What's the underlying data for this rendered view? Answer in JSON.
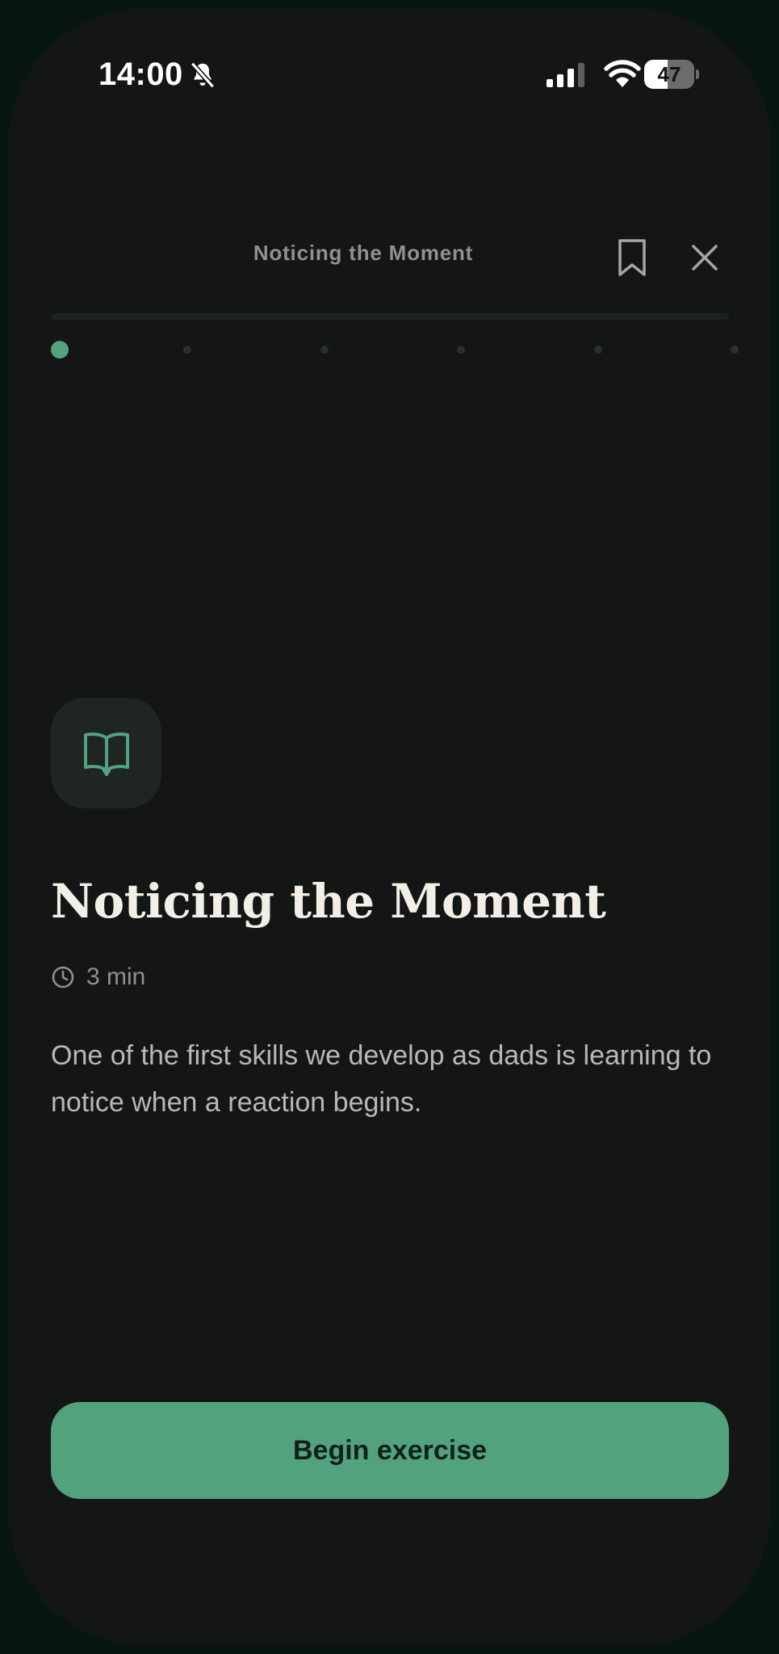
{
  "status_bar": {
    "time": "14:00",
    "battery_level": "47",
    "battery_fraction": 0.47,
    "icons": [
      "bell-slash-icon",
      "cellular-signal-icon",
      "wifi-icon",
      "battery-icon"
    ]
  },
  "header": {
    "title": "Noticing the Moment",
    "bookmark_icon": "bookmark-icon",
    "close_icon": "close-icon"
  },
  "progress": {
    "current_step": 1,
    "total_steps": 6,
    "fraction_complete": 0.0
  },
  "lesson": {
    "icon": "open-book-icon",
    "title": "Noticing the Moment",
    "duration_icon": "clock-icon",
    "duration": "3 min",
    "body": "One of the first skills we develop as dads is learning to notice when a reaction begins."
  },
  "actions": {
    "begin_label": "Begin exercise"
  },
  "colors": {
    "background": "#131615",
    "bezel": "#071613",
    "accent": "#52a27e",
    "title_text": "#f3efe6",
    "muted_text": "#8d918f",
    "body_text": "#b7b9b8",
    "icon_tile": "#1e2523"
  }
}
